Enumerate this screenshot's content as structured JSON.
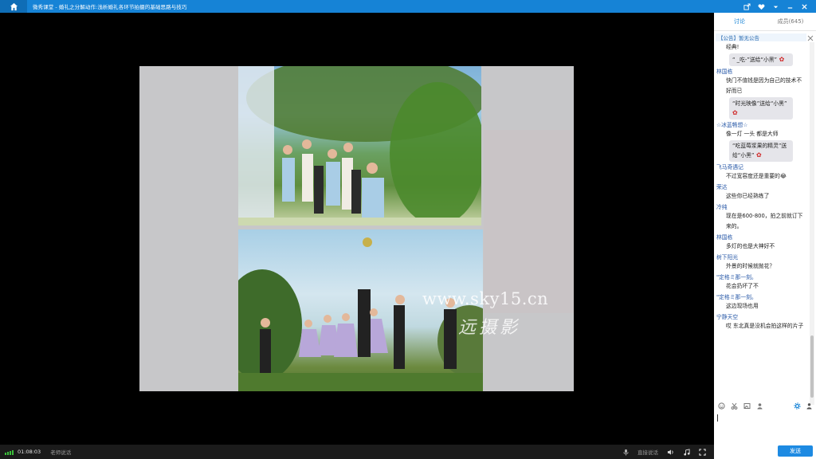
{
  "window": {
    "app_name": "微秀课堂",
    "separator": "-",
    "course_title": "婚礼之分解动作:浅析婚礼各环节拍摄的基础思路与技巧",
    "controls": [
      "share-icon",
      "heart-icon",
      "chevron-down-icon",
      "minimize-icon",
      "close-icon"
    ]
  },
  "stage": {
    "watermark_url": "www.sky15.cn",
    "watermark_logo": "远摄影"
  },
  "bottom": {
    "timer": "01:08:03",
    "teacher_speaking": "老师说话",
    "live_speech": "直接说话"
  },
  "side": {
    "tabs": [
      {
        "label": "讨论",
        "active": true
      },
      {
        "label": "成员(645)",
        "active": false
      }
    ],
    "notice": "【公告】暂无公告",
    "messages": [
      {
        "type": "text",
        "text": "经典!"
      },
      {
        "type": "gift",
        "text": "“        _吃-”送给“小黑”"
      },
      {
        "type": "name",
        "text": "林国栋"
      },
      {
        "type": "text",
        "text": "快门不值钱是因为自己的技术不好而已"
      },
      {
        "type": "gift",
        "text": "“时光映像”送给“小黑”"
      },
      {
        "type": "name",
        "text": "☆冰蓝畅想☆"
      },
      {
        "type": "text",
        "text": "像一灯 一头 都是大师"
      },
      {
        "type": "gift",
        "text": "“吃蓝莓浆果的精灵”送给“小黑”"
      },
      {
        "type": "name",
        "text": "飞马奇遇记"
      },
      {
        "type": "text",
        "text": "不过宽容度还是重要的😂"
      },
      {
        "type": "name",
        "text": "荣达"
      },
      {
        "type": "text",
        "text": "这些你已经熟练了"
      },
      {
        "type": "name",
        "text": "冷纯"
      },
      {
        "type": "text",
        "text": "现在是600-800，拍之前就订下来的。"
      },
      {
        "type": "name",
        "text": "林国栋"
      },
      {
        "type": "text",
        "text": "多灯的也是大神好不"
      },
      {
        "type": "name",
        "text": "树下阳光"
      },
      {
        "type": "text",
        "text": "外景的时候就抛花？"
      },
      {
        "type": "name",
        "text": "\"定格ミ那一刻。"
      },
      {
        "type": "text",
        "text": "花会扔坏了不"
      },
      {
        "type": "name",
        "text": "\"定格ミ那一刻。"
      },
      {
        "type": "text",
        "text": "这边现场也用"
      },
      {
        "type": "name",
        "text": "宁静天空"
      },
      {
        "type": "text",
        "text": "哎 东北真是没机会拍这样的片子"
      }
    ],
    "send_label": "发送"
  },
  "colors": {
    "titlebar": "#1683d6",
    "accent": "#1d8ae2",
    "name_text": "#2a5aa8"
  }
}
